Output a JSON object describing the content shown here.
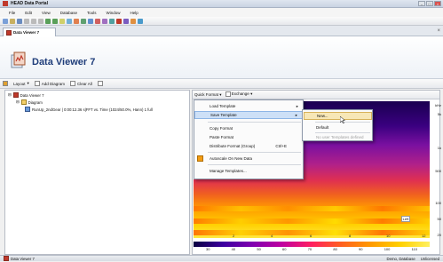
{
  "app": {
    "title": "HEAD Data Portal"
  },
  "menu": [
    "File",
    "Edit",
    "View",
    "Database",
    "Tools",
    "Window",
    "Help"
  ],
  "tab": {
    "label": "Data Viewer 7"
  },
  "header": {
    "title": "Data Viewer 7"
  },
  "subtoolbar": {
    "layout": "Layout",
    "add_diagram": "Add Diagram",
    "clear_all": "Clear All"
  },
  "tree": {
    "root": "Data Viewer 7",
    "diagram": "Diagram",
    "item": "RunUp_2ndGear | 0:00:12.36 s|FFT vs. Time (1024/50.0%, Hann) 1 full"
  },
  "right_toolbar": {
    "quick_format": "Quick Format",
    "exchange": "Exchange"
  },
  "context_menu": {
    "items": [
      "Load Template",
      "Save Template",
      "Copy Format",
      "Paste Format",
      "Distribute Format (Group)",
      "Autoscale On New Data",
      "Manage Templates..."
    ],
    "shortcut": "Ctrl+E"
  },
  "submenu": {
    "items": [
      "New...",
      "Default",
      "No user Templates defined"
    ]
  },
  "axis": {
    "y_right": [
      "kHz",
      "5k",
      "1k",
      "500",
      "100",
      "50",
      "20"
    ],
    "x_top": [
      "2",
      "4",
      "6",
      "8",
      "10",
      "12"
    ],
    "x_bottom": [
      "30",
      "40",
      "50",
      "60",
      "70",
      "80",
      "90",
      "100",
      "110"
    ]
  },
  "plot_label": "Left",
  "status": {
    "left": "Data Viewer 7",
    "right1": "Demo, Database",
    "right2": "Unlicensed"
  },
  "colors": {
    "accent": "#1f3d7a",
    "highlight": "#cde0f7"
  }
}
